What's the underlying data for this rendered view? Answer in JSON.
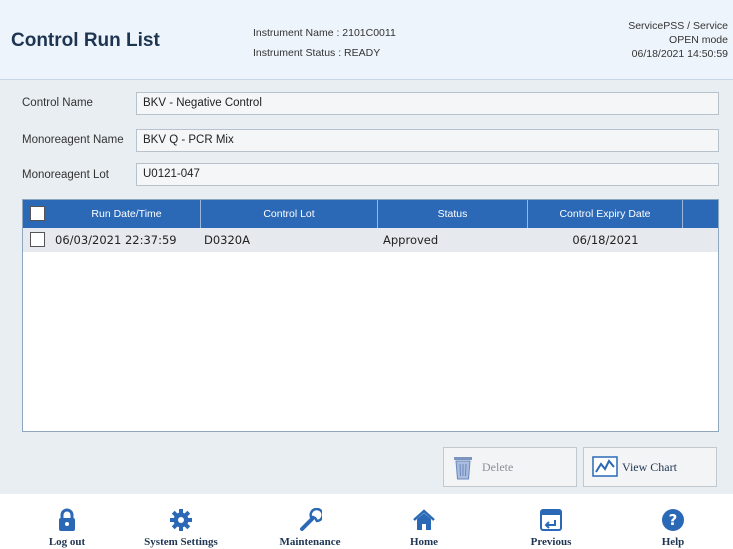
{
  "header": {
    "title": "Control Run List",
    "instrument_name": "Instrument Name : 2101C0011",
    "instrument_status": "Instrument Status : READY",
    "user": "ServicePSS / Service",
    "mode": "OPEN mode",
    "datetime": "06/18/2021 14:50:59"
  },
  "fields": {
    "control_name_label": "Control Name",
    "control_name_value": "BKV - Negative Control",
    "monoreagent_name_label": "Monoreagent Name",
    "monoreagent_name_value": "BKV Q - PCR Mix",
    "monoreagent_lot_label": "Monoreagent Lot",
    "monoreagent_lot_value": "U0121-047"
  },
  "table": {
    "columns": [
      "Run Date/Time",
      "Control Lot",
      "Status",
      "Control Expiry Date"
    ],
    "rows": [
      {
        "run_datetime": "06/03/2021 22:37:59",
        "control_lot": "D0320A",
        "status": "Approved",
        "expiry": "06/18/2021"
      }
    ]
  },
  "actions": {
    "delete_label": "Delete",
    "view_chart_label": "View Chart"
  },
  "nav": {
    "logout": "Log out",
    "system_settings": "System Settings",
    "maintenance": "Maintenance",
    "home": "Home",
    "previous": "Previous",
    "help": "Help"
  },
  "colors": {
    "header_blue": "#2b69b6",
    "title_navy": "#1e3552"
  },
  "icons": {
    "delete": "trash-icon",
    "view_chart": "chart-icon",
    "logout": "lock-icon",
    "system_settings": "gear-icon",
    "maintenance": "wrench-icon",
    "home": "home-icon",
    "previous": "previous-icon",
    "help": "help-icon"
  }
}
